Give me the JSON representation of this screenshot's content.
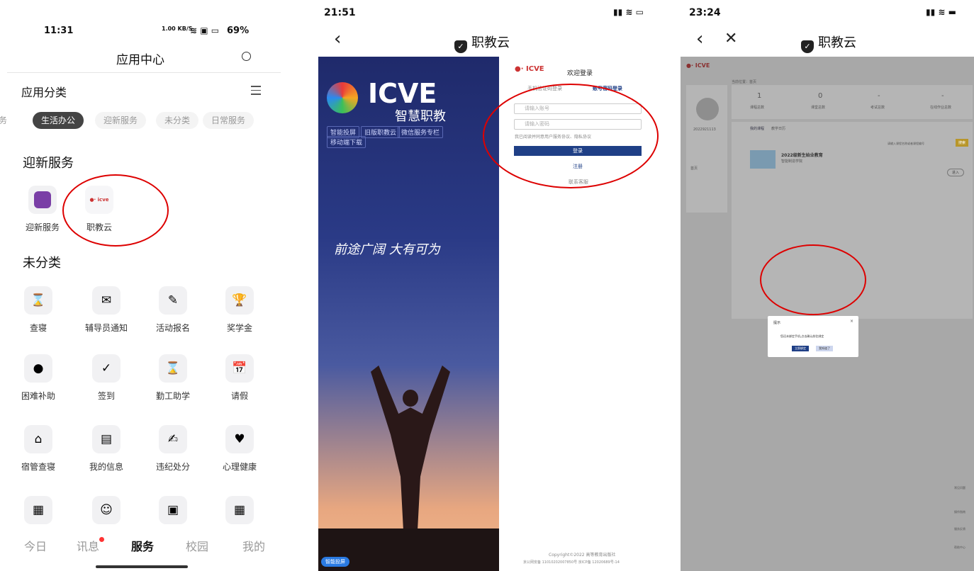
{
  "panel1": {
    "status": {
      "time": "11:31",
      "speed": "1.00 KB/S",
      "battery": "69%"
    },
    "title": "应用中心",
    "category_header": "应用分类",
    "chips": [
      "务",
      "生活办公",
      "迎新服务",
      "未分类",
      "日常服务"
    ],
    "section_welcome": "迎新服务",
    "welcome_apps": [
      {
        "label": "迎新服务",
        "icon": "welcome-icon",
        "color": "#7a3fa6"
      },
      {
        "label": "职教云",
        "icon": "icve-logo-icon",
        "color": "#ffffff"
      }
    ],
    "section_uncat": "未分类",
    "apps": [
      {
        "label": "查寝",
        "icon": "dorm-check-icon",
        "glyph": "⌛"
      },
      {
        "label": "辅导员通知",
        "icon": "notice-icon",
        "glyph": "✉"
      },
      {
        "label": "活动报名",
        "icon": "signup-icon",
        "glyph": "✎"
      },
      {
        "label": "奖学金",
        "icon": "trophy-icon",
        "glyph": "🏆"
      },
      {
        "label": "困难补助",
        "icon": "subsidy-icon",
        "glyph": "●"
      },
      {
        "label": "签到",
        "icon": "checkin-icon",
        "glyph": "✓"
      },
      {
        "label": "勤工助学",
        "icon": "work-study-icon",
        "glyph": "⌛"
      },
      {
        "label": "请假",
        "icon": "leave-calendar-icon",
        "glyph": "📅"
      },
      {
        "label": "宿管查寝",
        "icon": "dorm-home-icon",
        "glyph": "⌂"
      },
      {
        "label": "我的信息",
        "icon": "id-card-icon",
        "glyph": "▤"
      },
      {
        "label": "违纪处分",
        "icon": "discipline-icon",
        "glyph": "✍"
      },
      {
        "label": "心理健康",
        "icon": "heart-icon",
        "glyph": "♥"
      },
      {
        "label": "",
        "icon": "building-icon",
        "glyph": "▦"
      },
      {
        "label": "",
        "icon": "teacher-icon",
        "glyph": "☺"
      },
      {
        "label": "",
        "icon": "document-icon",
        "glyph": "▣"
      },
      {
        "label": "",
        "icon": "vooc-calendar-icon",
        "glyph": "▦"
      }
    ],
    "tabs": [
      "今日",
      "讯息",
      "服务",
      "校园",
      "我的"
    ],
    "active_tab": "服务"
  },
  "panel2": {
    "status": {
      "time": "21:51"
    },
    "nav_title": "职教云",
    "logo_text": "ICVE",
    "logo_sub": "智慧职教",
    "hero_tags": [
      "智能投屏",
      "旧版职教云",
      "微信服务专栏",
      "移动端下载"
    ],
    "hero_slogan": "前途广阔 大有可为",
    "welcome": "欢迎登录",
    "login_tabs": [
      "手机验证码登录",
      "账号密码登录"
    ],
    "account_placeholder": "请输入账号",
    "password_placeholder": "请输入密码",
    "agreement": "我已阅读并同意用户服务协议、隐私协议",
    "login_button": "登录",
    "register_link": "注册",
    "contact": "联系客服",
    "footer_copyright": "Copyright©2022 高等教育出版社",
    "footer_icp": "京公网安备 11010202007850号 京ICP备 12020689号-14",
    "float_tag": "智能投屏"
  },
  "panel3": {
    "status": {
      "time": "23:24"
    },
    "nav_title": "职教云",
    "breadcrumb": "当前位置：首页",
    "stats": [
      {
        "value": "1",
        "label": "课程总数"
      },
      {
        "value": "0",
        "label": "课堂总数"
      },
      {
        "value": "-",
        "label": "考试总数"
      },
      {
        "value": "-",
        "label": "在线作业总数"
      }
    ],
    "user_id": "2022921113",
    "menu_home": "首页",
    "tabs": [
      "我的课程",
      "教学日历"
    ],
    "search_placeholder": "请输入课程名称或者课程编号",
    "search_button": "搜索",
    "course_title": "2022级新生始业教育",
    "course_school": "智能制造学院",
    "enter_button": "进入",
    "dialog_title": "提示",
    "dialog_text": "您还未绑定手机,点击确认前往绑定",
    "dialog_confirm": "立即绑定",
    "dialog_cancel": "我知道了",
    "side_tools": [
      "常见问题",
      "操作指南",
      "服务反馈",
      "帮助中心"
    ]
  }
}
